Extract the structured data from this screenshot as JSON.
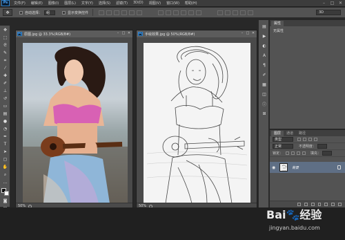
{
  "menubar": {
    "logo": "Ps",
    "items": [
      "文件(F)",
      "编辑(E)",
      "图像(I)",
      "图层(L)",
      "文字(Y)",
      "选择(S)",
      "滤镜(T)",
      "3D(D)",
      "视图(V)",
      "窗口(W)",
      "帮助(H)"
    ],
    "minimize": "–",
    "maximize": "□",
    "close": "✕"
  },
  "options": {
    "auto_select_label": "自动选择：",
    "auto_select_value": "组",
    "show_transform_label": "显示变换控件",
    "workspace": "3D"
  },
  "documents": [
    {
      "title": "原图.jpg @ 33.3%(RGB/8#)",
      "zoom": "50%"
    },
    {
      "title": "手绘效果.jpg @ 50%(RGB/8#)",
      "zoom": "50%"
    }
  ],
  "properties": {
    "tab": "属性",
    "body": "无属性"
  },
  "layers": {
    "tabs": [
      "图层",
      "通道",
      "路径"
    ],
    "kind": "类型",
    "blend": "正常",
    "opacity_label": "不透明度：",
    "lock_label": "锁定：",
    "fill_label": "填充：",
    "layer_name": "背景"
  },
  "watermark": {
    "logo": "Bai🐾经验",
    "url": "jingyan.baidu.com"
  }
}
